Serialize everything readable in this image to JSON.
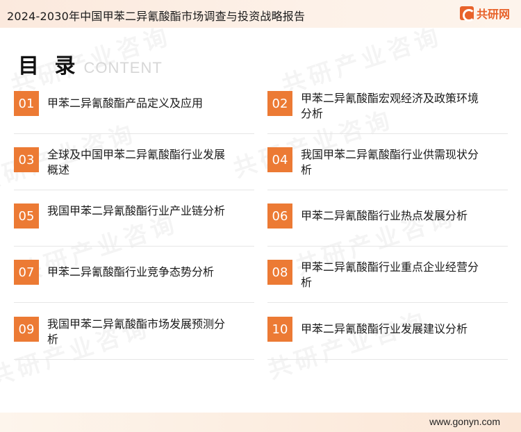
{
  "header": {
    "title": "2024-2030年中国甲苯二异氰酸酯市场调查与投资战略报告",
    "brand": "共研网"
  },
  "toc": {
    "heading": "目 录",
    "heading_sub": "CONTENT",
    "items": [
      {
        "num": "01",
        "label": "甲苯二异氰酸酯产品定义及应用"
      },
      {
        "num": "02",
        "label": "甲苯二异氰酸酯宏观经济及政策环境分析"
      },
      {
        "num": "03",
        "label": "全球及中国甲苯二异氰酸酯行业发展概述"
      },
      {
        "num": "04",
        "label": "我国甲苯二异氰酸酯行业供需现状分析"
      },
      {
        "num": "05",
        "label": "我国甲苯二异氰酸酯行业产业链分析"
      },
      {
        "num": "06",
        "label": "甲苯二异氰酸酯行业热点发展分析"
      },
      {
        "num": "07",
        "label": "甲苯二异氰酸酯行业竞争态势分析"
      },
      {
        "num": "08",
        "label": "甲苯二异氰酸酯行业重点企业经营分析"
      },
      {
        "num": "09",
        "label": "我国甲苯二异氰酸酯市场发展预测分析"
      },
      {
        "num": "10",
        "label": "甲苯二异氰酸酯行业发展建议分析"
      }
    ]
  },
  "watermark": {
    "text": "共研产业咨询",
    "url": "www.gonyn.com"
  },
  "footer": {
    "url": "www.gonyn.com"
  },
  "colors": {
    "accent": "#ec7a34",
    "brand": "#e8622a"
  }
}
